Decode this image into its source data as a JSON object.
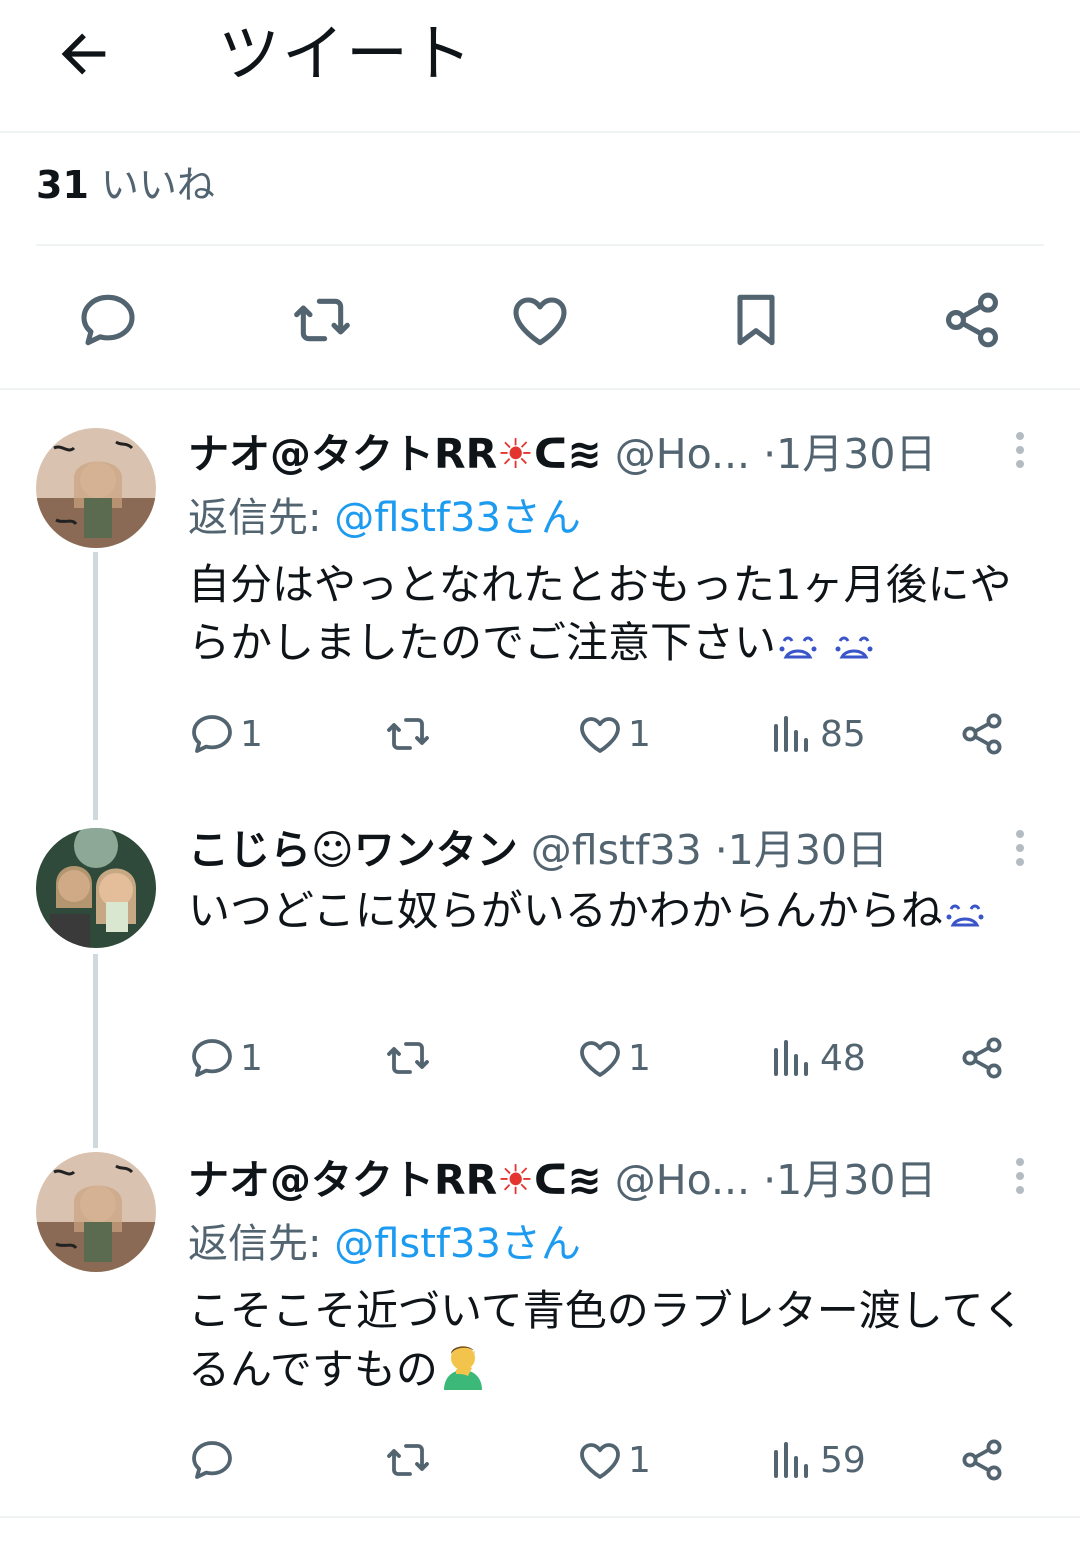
{
  "header": {
    "title": "ツイート",
    "back_icon": "arrow-left-icon"
  },
  "likes": {
    "count": "31",
    "label": "いいね"
  },
  "actions": [
    "reply-icon",
    "retweet-icon",
    "like-icon",
    "bookmark-icon",
    "share-icon"
  ],
  "colors": {
    "text": "#0f1419",
    "secondary": "#536471",
    "accent": "#1d9bf0",
    "divider": "#eff3f4",
    "thread": "#cfd9de"
  },
  "replies": [
    {
      "name": "ナオ@タクトRR",
      "name_suffix": "☀ᑕ≋",
      "handle": "@Ho...",
      "dot": "·",
      "date": "1月30日",
      "replying_label": "返信先: ",
      "replying_to": "@flstf33さん",
      "text": "自分はやっとなれたとおもった1ヶ月後にやらかしましたのでご注意下さい",
      "emoji": "weary-face-emoji",
      "stats": {
        "replies": "1",
        "retweets": "",
        "likes": "1",
        "views": "85"
      }
    },
    {
      "name": "こじら☺ワンタン",
      "name_suffix": "",
      "handle": "@flstf33",
      "dot": "·",
      "date": "1月30日",
      "replying_label": "",
      "replying_to": "",
      "text": "いつどこに奴らがいるかわからんからね",
      "emoji": "weary-face-emoji",
      "stats": {
        "replies": "1",
        "retweets": "",
        "likes": "1",
        "views": "48"
      }
    },
    {
      "name": "ナオ@タクトRR",
      "name_suffix": "☀ᑕ≋",
      "handle": "@Ho...",
      "dot": "·",
      "date": "1月30日",
      "replying_label": "返信先: ",
      "replying_to": "@flstf33さん",
      "text": "こそこそ近づいて青色のラブレター渡してくるんですもの",
      "emoji": "facepalm-emoji",
      "stats": {
        "replies": "",
        "retweets": "",
        "likes": "1",
        "views": "59"
      }
    }
  ]
}
